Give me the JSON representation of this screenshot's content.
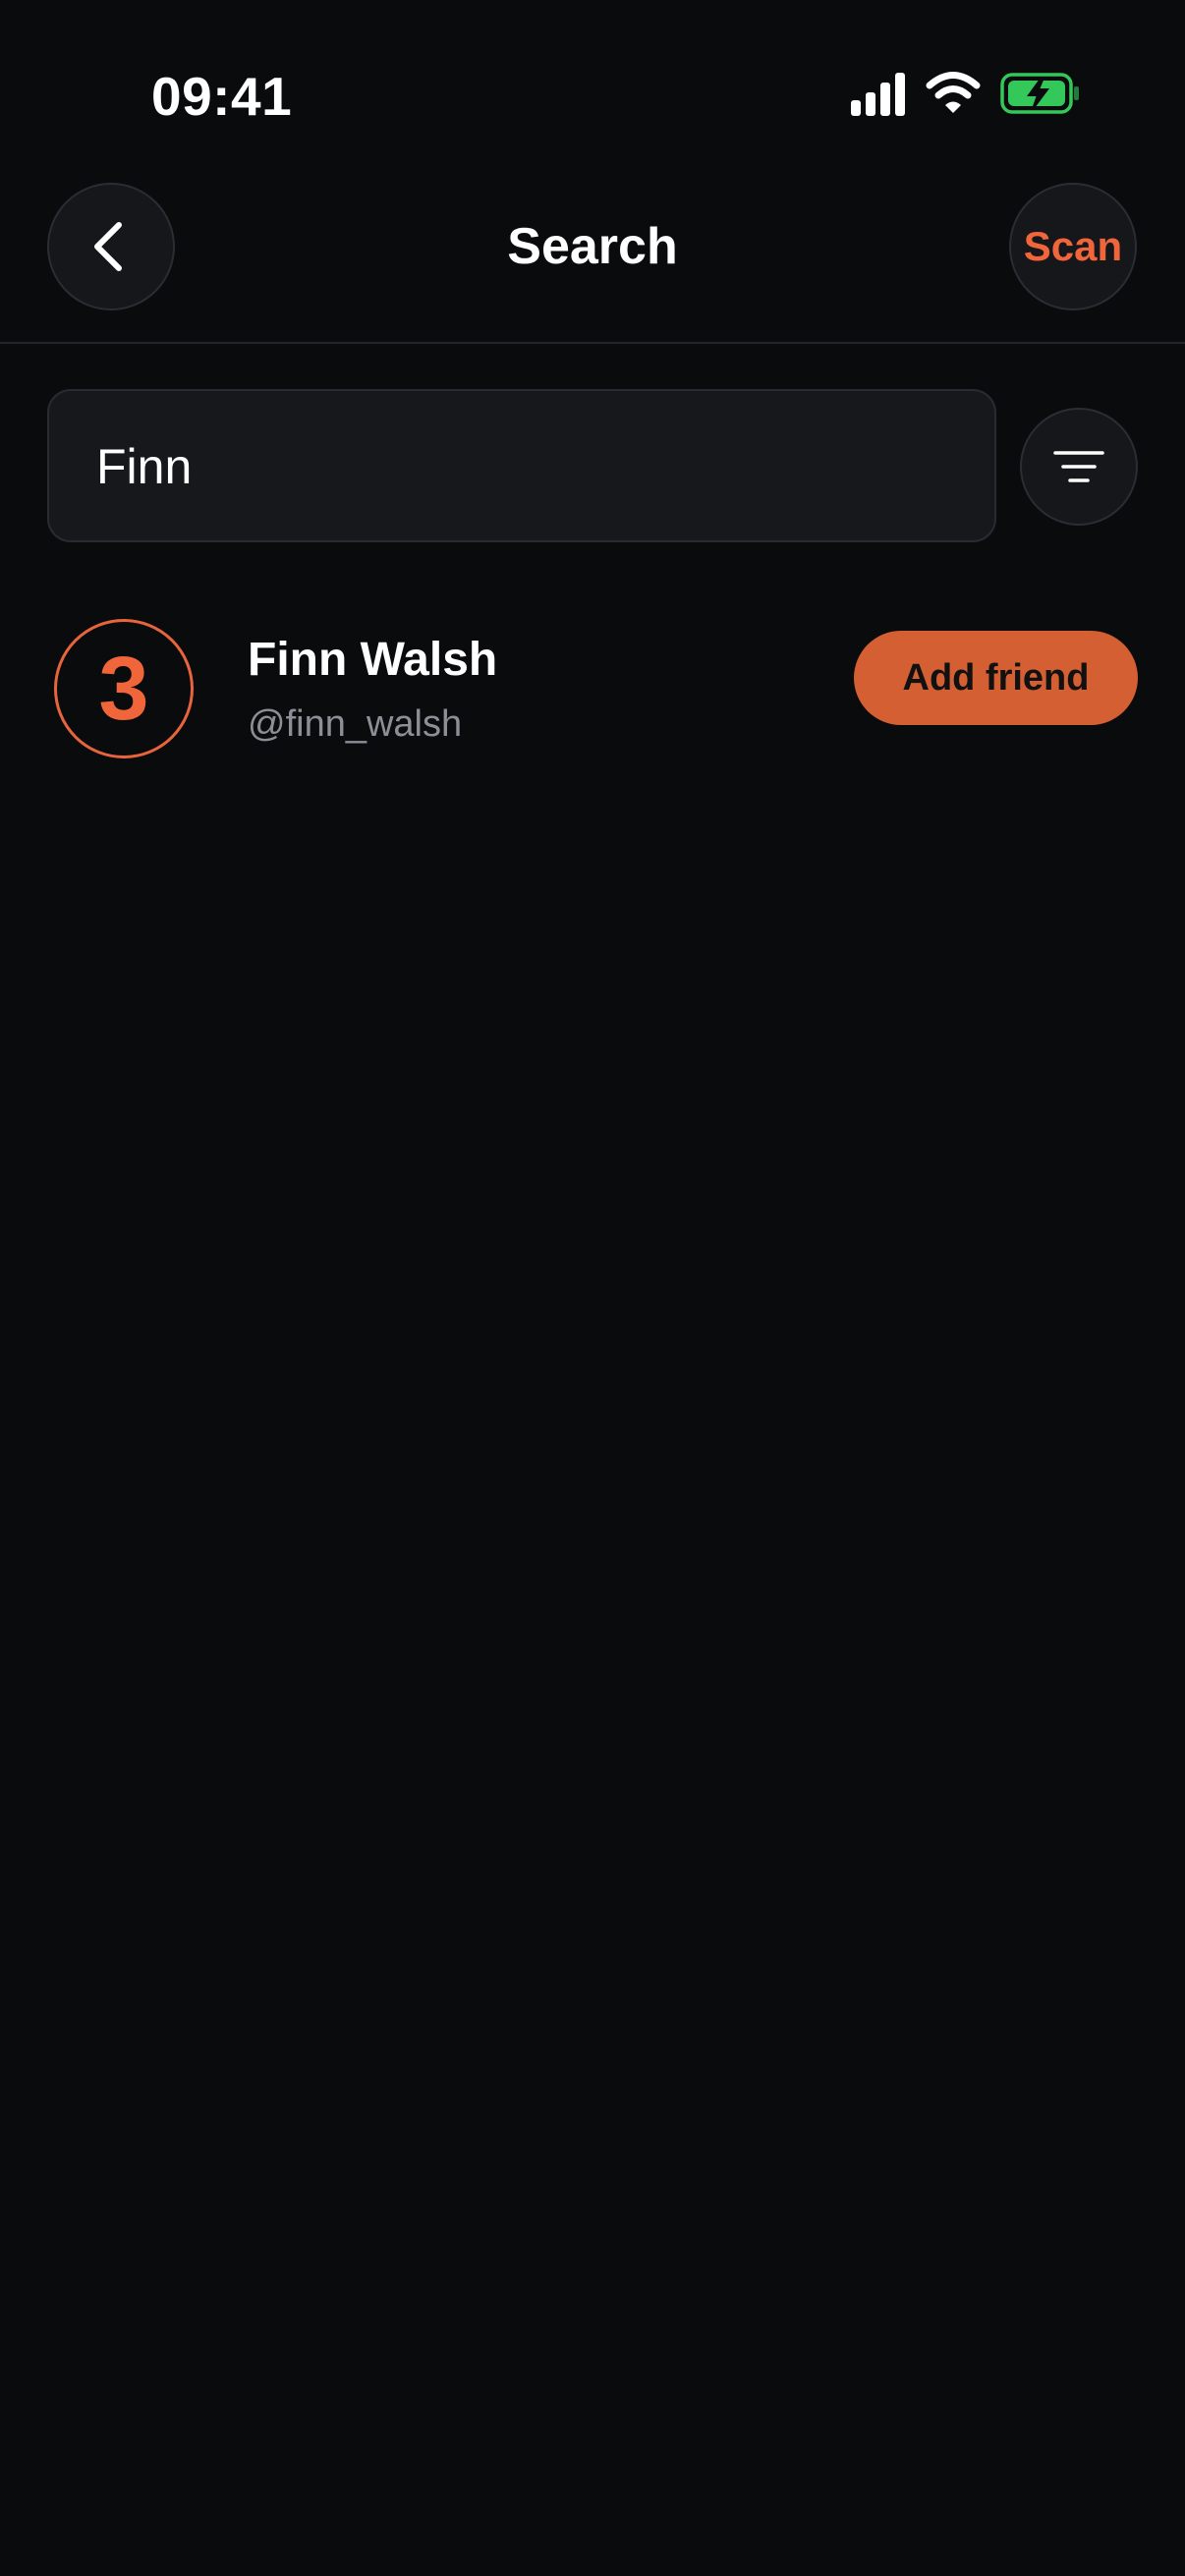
{
  "status_bar": {
    "time": "09:41",
    "icons": [
      "cellular-signal-icon",
      "wifi-icon",
      "battery-charging-icon"
    ],
    "battery_color": "#34c759"
  },
  "nav": {
    "title": "Search",
    "back_icon": "chevron-left-icon",
    "scan_label": "Scan"
  },
  "search": {
    "value": "Finn",
    "filter_icon": "filter-lines-icon"
  },
  "results": [
    {
      "avatar_text": "3",
      "name": "Finn Walsh",
      "handle": "@finn_walsh",
      "action_label": "Add friend"
    }
  ],
  "colors": {
    "background": "#0a0b0d",
    "accent": "#f0653a",
    "button_fill": "#d45f32",
    "muted_text": "#8d8f96"
  }
}
